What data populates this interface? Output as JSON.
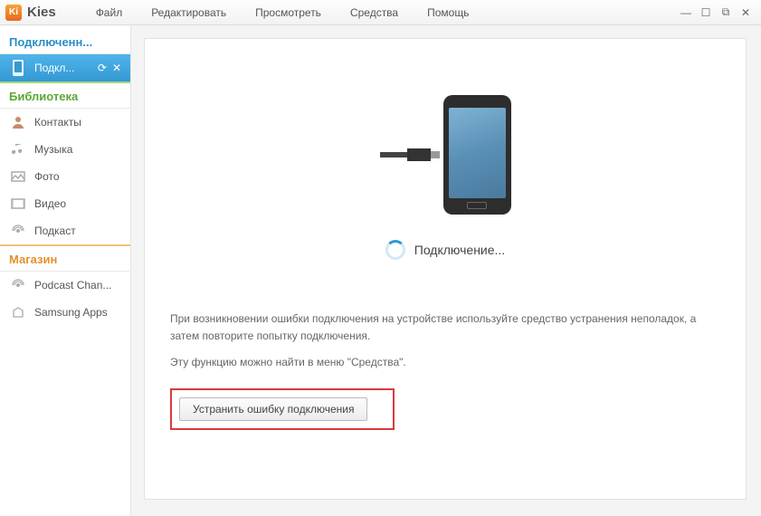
{
  "app": {
    "logo_text": "Ki",
    "name": "Kies"
  },
  "menubar": {
    "items": [
      "Файл",
      "Редактировать",
      "Просмотреть",
      "Средства",
      "Помощь"
    ]
  },
  "sidebar": {
    "connected_header": "Подключенн...",
    "device_label": "Подкл...",
    "library_header": "Библиотека",
    "library": {
      "contacts": "Контакты",
      "music": "Музыка",
      "photo": "Фото",
      "video": "Видео",
      "podcast": "Подкаст"
    },
    "store_header": "Магазин",
    "store": {
      "podcast_channel": "Podcast Chan...",
      "samsung_apps": "Samsung Apps"
    }
  },
  "main": {
    "status": "Подключение...",
    "help_line1": "При возникновении ошибки подключения на устройстве используйте средство устранения неполадок, а затем повторите попытку подключения.",
    "help_line2": "Эту функцию можно найти в меню \"Средства\".",
    "fix_button": "Устранить ошибку подключения"
  }
}
